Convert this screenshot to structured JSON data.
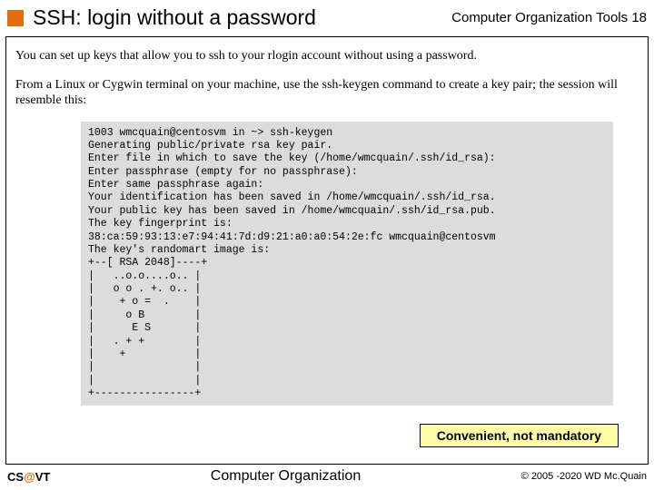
{
  "header": {
    "title": "SSH: login without a password",
    "section": "Computer Organization Tools",
    "pageNumber": "18"
  },
  "body": {
    "para1": "You can set up keys that allow you to ssh to your rlogin account without using a password.",
    "para2": "From a Linux or Cygwin terminal on your machine, use the ssh-keygen command to create a key pair; the session will resemble this:",
    "code": "1003 wmcquain@centosvm in ~> ssh-keygen\nGenerating public/private rsa key pair.\nEnter file in which to save the key (/home/wmcquain/.ssh/id_rsa):\nEnter passphrase (empty for no passphrase):\nEnter same passphrase again:\nYour identification has been saved in /home/wmcquain/.ssh/id_rsa.\nYour public key has been saved in /home/wmcquain/.ssh/id_rsa.pub.\nThe key fingerprint is:\n38:ca:59:93:13:e7:94:41:7d:d9:21:a0:a0:54:2e:fc wmcquain@centosvm\nThe key's randomart image is:\n+--[ RSA 2048]----+\n|   ..o.o....o.. |\n|   o o . +. o.. |\n|    + o =  .    |\n|     o B        |\n|      E S       |\n|   . + +        |\n|    +           |\n|                |\n|                |\n+----------------+",
    "callout": "Convenient, not mandatory"
  },
  "footer": {
    "left_prefix": "CS",
    "left_at": "@",
    "left_suffix": "VT",
    "center": "Computer Organization",
    "right": "© 2005 -2020 WD Mc.Quain"
  }
}
